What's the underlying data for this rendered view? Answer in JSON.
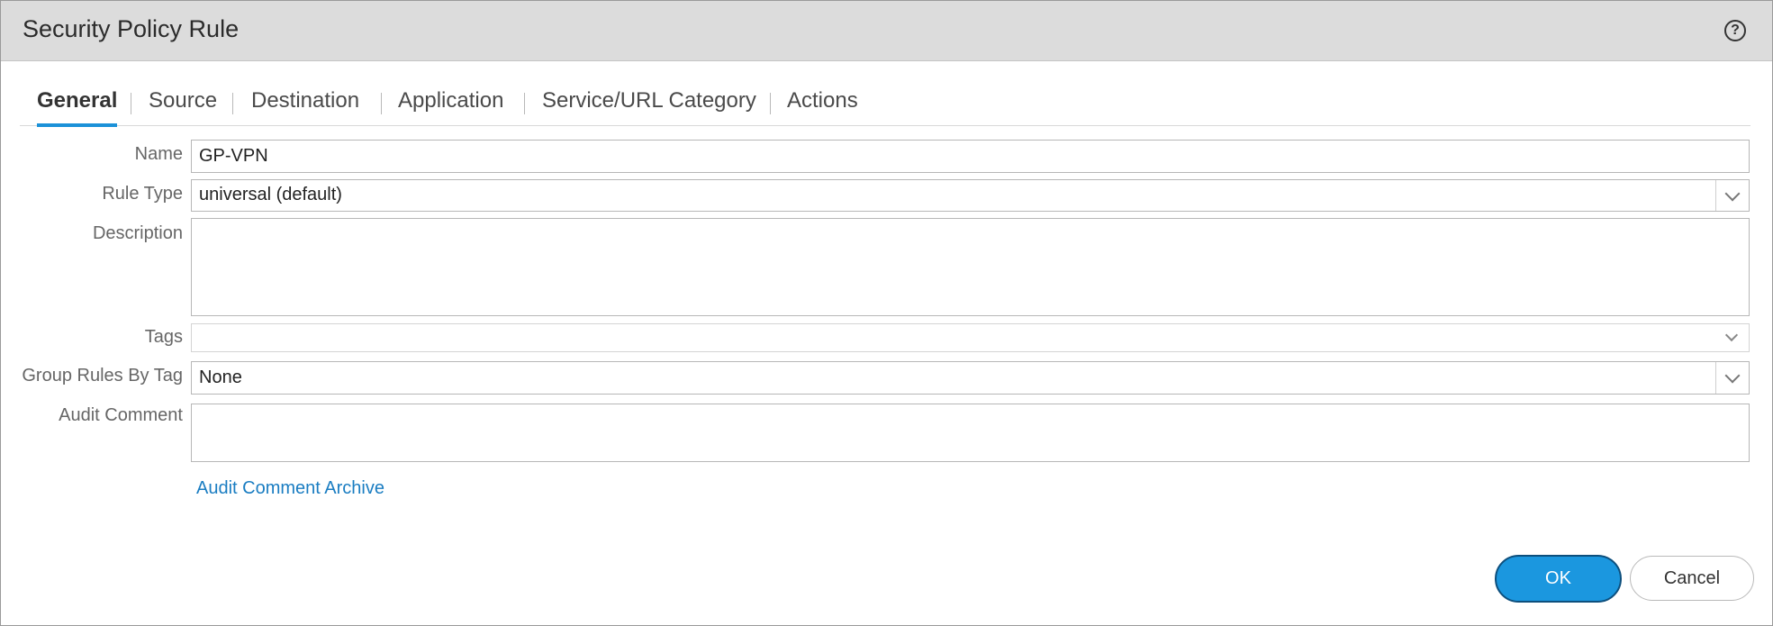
{
  "dialog": {
    "title": "Security Policy Rule",
    "help_icon": "question-circle-icon"
  },
  "tabs": [
    {
      "label": "General",
      "active": true
    },
    {
      "label": "Source",
      "active": false
    },
    {
      "label": "Destination",
      "active": false
    },
    {
      "label": "Application",
      "active": false
    },
    {
      "label": "Service/URL Category",
      "active": false
    },
    {
      "label": "Actions",
      "active": false
    }
  ],
  "form": {
    "name": {
      "label": "Name",
      "value": "GP-VPN"
    },
    "rule_type": {
      "label": "Rule Type",
      "value": "universal (default)"
    },
    "description": {
      "label": "Description",
      "value": ""
    },
    "tags": {
      "label": "Tags",
      "value": ""
    },
    "group_rules_by_tag": {
      "label": "Group Rules By Tag",
      "value": "None"
    },
    "audit_comment": {
      "label": "Audit Comment",
      "value": ""
    },
    "audit_comment_archive_link": "Audit Comment Archive"
  },
  "buttons": {
    "ok": "OK",
    "cancel": "Cancel"
  },
  "colors": {
    "accent": "#1b91d8",
    "header_bg": "#dcdcdc",
    "link": "#1a7dc2",
    "ok_button": "#1b97df"
  }
}
